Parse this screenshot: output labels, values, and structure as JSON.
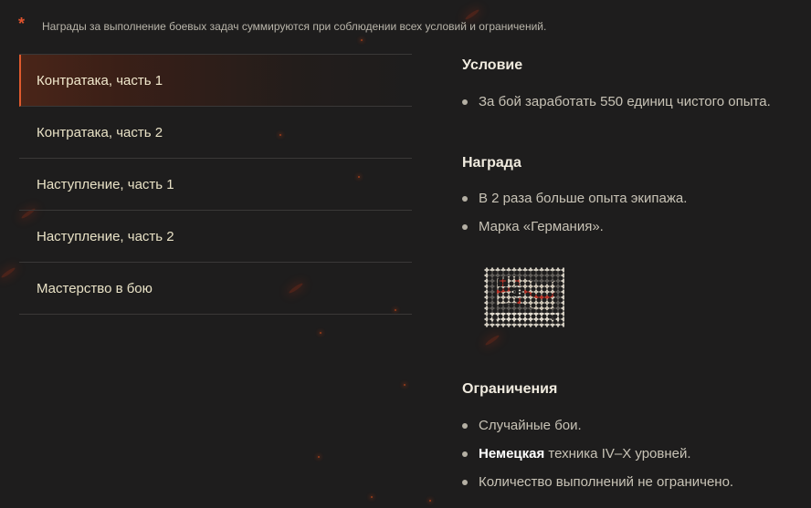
{
  "note": {
    "asterisk": "*",
    "text": "Награды за выполнение боевых задач суммируются при соблюдении всех условий и ограничений."
  },
  "tabs": [
    {
      "label": "Контратака, часть 1",
      "active": true
    },
    {
      "label": "Контратака, часть 2",
      "active": false
    },
    {
      "label": "Наступление, часть 1",
      "active": false
    },
    {
      "label": "Наступление, часть 2",
      "active": false
    },
    {
      "label": "Мастерство в бою",
      "active": false
    }
  ],
  "condition": {
    "title": "Условие",
    "items": [
      "За бой заработать 550 единиц чистого опыта."
    ]
  },
  "reward": {
    "title": "Награда",
    "items": [
      "В 2 раза больше опыта экипажа.",
      "Марка «Германия»."
    ],
    "stamp_icon": "germany-flag-stamp-icon"
  },
  "restrictions": {
    "title": "Ограничения",
    "item_1": "Случайные бои.",
    "item_2_bold": "Немецкая",
    "item_2_rest": " техника IV–X уровней.",
    "item_3": "Количество выполнений не ограничено."
  },
  "colors": {
    "accent": "#e05a2d",
    "background": "#1e1d1d",
    "tab_text": "#e9e2c6"
  }
}
